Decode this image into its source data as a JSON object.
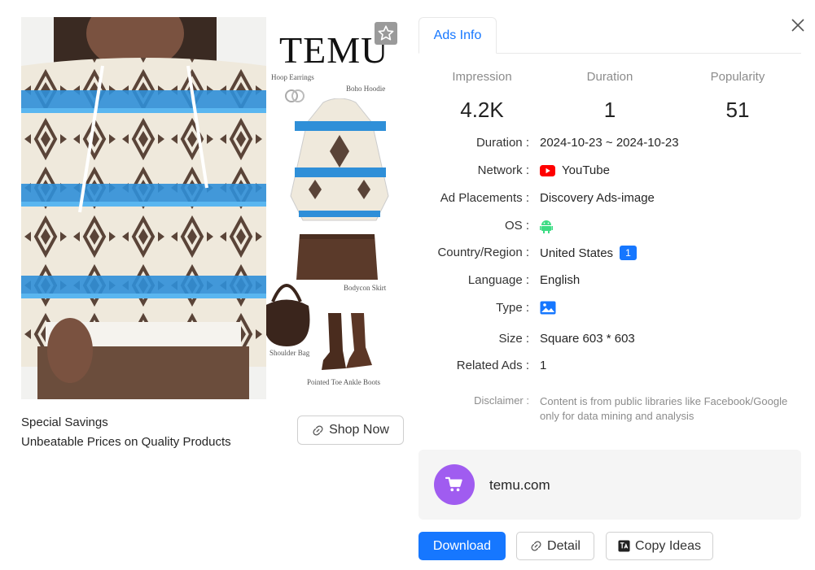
{
  "creative": {
    "brand_logo": "TEMU",
    "captions": {
      "earrings": "Hoop Earrings",
      "hoodie": "Boho Hoodie",
      "skirt": "Bodycon Skirt",
      "bag": "Shoulder Bag",
      "boots": "Pointed Toe Ankle Boots"
    },
    "favorite_icon": "star-icon"
  },
  "ad": {
    "headline": "Special Savings",
    "description": "Unbeatable Prices on Quality Products",
    "cta_label": "Shop Now",
    "cta_icon": "link-icon"
  },
  "panel": {
    "tab_label": "Ads Info",
    "close_icon": "close-icon",
    "stats": [
      {
        "label": "Impression",
        "value": "4.2K"
      },
      {
        "label": "Duration",
        "value": "1"
      },
      {
        "label": "Popularity",
        "value": "51"
      }
    ],
    "details": {
      "duration_key": "Duration :",
      "duration_val": "2024-10-23 ~ 2024-10-23",
      "network_key": "Network :",
      "network_val": "YouTube",
      "placements_key": "Ad Placements :",
      "placements_val": "Discovery Ads-image",
      "os_key": "OS :",
      "os_icon": "android-icon",
      "country_key": "Country/Region :",
      "country_val": "United States",
      "country_count": "1",
      "language_key": "Language :",
      "language_val": "English",
      "type_key": "Type :",
      "type_icon": "image-icon",
      "size_key": "Size :",
      "size_val": "Square 603 * 603",
      "related_key": "Related Ads :",
      "related_val": "1"
    },
    "disclaimer_key": "Disclaimer :",
    "disclaimer_val": "Content is from public libraries like Facebook/Google only for data mining and analysis",
    "site": {
      "name": "temu.com",
      "icon": "shopping-cart-icon"
    },
    "actions": {
      "download_label": "Download",
      "detail_label": "Detail",
      "copy_label": "Copy Ideas"
    }
  },
  "colors": {
    "accent": "#1677ff",
    "site_icon_bg": "#a05cf0",
    "youtube_red": "#ff0000",
    "android_green": "#3ddc84"
  }
}
